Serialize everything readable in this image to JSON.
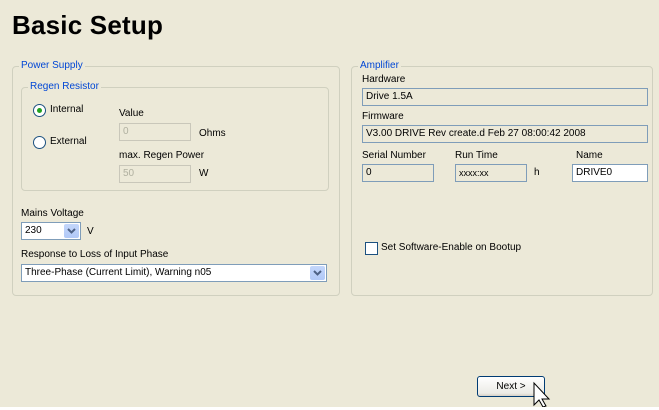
{
  "page": {
    "title": "Basic Setup"
  },
  "power_supply": {
    "legend": "Power Supply",
    "regen": {
      "legend": "Regen Resistor",
      "options": [
        {
          "label": "Internal",
          "selected": true
        },
        {
          "label": "External",
          "selected": false
        }
      ],
      "value_label": "Value",
      "value": "0",
      "value_unit": "Ohms",
      "max_power_label": "max. Regen Power",
      "max_power": "50",
      "max_power_unit": "W"
    },
    "mains_voltage_label": "Mains Voltage",
    "mains_voltage": "230",
    "mains_voltage_unit": "V",
    "loss_label": "Response to Loss of Input Phase",
    "loss_value": "Three-Phase (Current Limit), Warning n05"
  },
  "amplifier": {
    "legend": "Amplifier",
    "hardware_label": "Hardware",
    "hardware": "Drive 1.5A",
    "firmware_label": "Firmware",
    "firmware": "V3.00 DRIVE Rev create.d Feb 27 08:00:42 2008",
    "serial_label": "Serial Number",
    "serial": "0",
    "runtime_label": "Run Time",
    "runtime": "xxxx:xx",
    "runtime_unit": "h",
    "name_label": "Name",
    "name": "DRIVE0",
    "software_enable_label": "Set Software-Enable on Bootup",
    "software_enable_checked": false
  },
  "footer": {
    "next_label": "Next >"
  },
  "icons": {
    "dropdown": "chevron-down-icon",
    "cursor": "hand-pointer-icon"
  },
  "colors": {
    "background": "#ece9d8",
    "legend": "#0046d5",
    "border": "#7f9db9"
  }
}
